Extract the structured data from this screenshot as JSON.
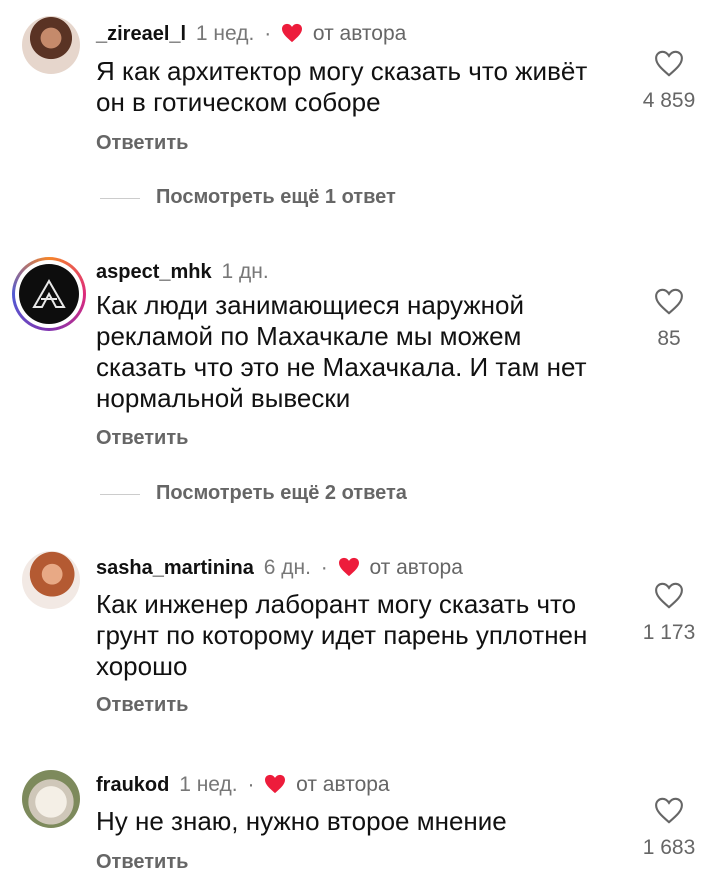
{
  "comments": [
    {
      "username": "_zireael_l",
      "time": "1 нед.",
      "separator": "·",
      "author_badge": "от автора",
      "text_lines": [
        "Я как архитектор могу сказать что живёт",
        "он в готическом соборе"
      ],
      "reply_label": "Ответить",
      "likes": "4 859",
      "more_replies": "Посмотреть ещё 1 ответ"
    },
    {
      "username": "aspect_mhk",
      "time": "1 дн.",
      "text_lines": [
        "Как люди занимающиеся наружной",
        "рекламой по Махачкале мы можем",
        "сказать что это не Махачкала. И там нет",
        "нормальной вывески"
      ],
      "reply_label": "Ответить",
      "likes": "85",
      "more_replies": "Посмотреть ещё 2 ответа"
    },
    {
      "username": "sasha_martinina",
      "time": "6 дн.",
      "separator": "·",
      "author_badge": "от автора",
      "text_lines": [
        "Как инженер лаборант могу сказать что",
        "грунт по которому идет парень уплотнен",
        "хорошо"
      ],
      "reply_label": "Ответить",
      "likes": "1 173"
    },
    {
      "username": "fraukod",
      "time": "1 нед.",
      "separator": "·",
      "author_badge": "от автора",
      "text_lines": [
        "Ну не знаю, нужно второе мнение"
      ],
      "reply_label": "Ответить",
      "likes": "1 683"
    }
  ],
  "colors": {
    "heart_red": "#ed1c3b",
    "muted": "#666666",
    "text": "#111111"
  },
  "icons": {
    "like": "heart-outline-icon",
    "author_like": "heart-filled-icon"
  }
}
